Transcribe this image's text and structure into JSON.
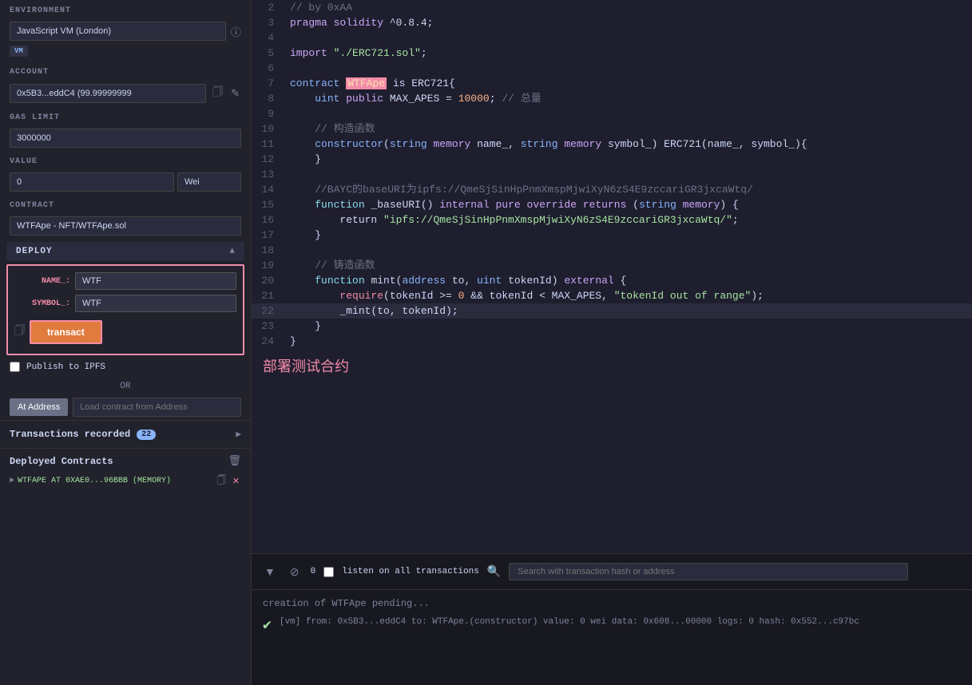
{
  "left_panel": {
    "environment_label": "ENVIRONMENT",
    "environment_value": "JavaScript VM (London)",
    "vm_badge": "VM",
    "account_label": "ACCOUNT",
    "account_value": "0x5B3...eddC4 (99.99999999",
    "gas_limit_label": "GAS LIMIT",
    "gas_limit_value": "3000000",
    "value_label": "VALUE",
    "value_value": "0",
    "value_unit": "Wei",
    "contract_label": "CONTRACT",
    "contract_value": "WTFApe - NFT/WTFApe.sol",
    "deploy_label": "DEPLOY",
    "name_param_label": "NAME_:",
    "name_param_value": "WTF",
    "symbol_param_label": "SYMBOL_:",
    "symbol_param_value": "WTF",
    "transact_btn": "transact",
    "publish_label": "Publish to IPFS",
    "or_text": "OR",
    "at_address_btn": "At Address",
    "load_contract_placeholder": "Load contract from Address",
    "transactions_label": "Transactions recorded",
    "transactions_count": "22",
    "deployed_contracts_label": "Deployed Contracts",
    "deployed_item": "WTFAPE AT 0XAE0...96BBB (MEMORY)"
  },
  "toolbar": {
    "count": "0",
    "listen_label": "listen on all transactions",
    "search_placeholder": "Search with transaction hash or address"
  },
  "code": {
    "lines": [
      {
        "num": 2,
        "content": "// by 0xAA"
      },
      {
        "num": 3,
        "content": "pragma solidity ^0.8.4;"
      },
      {
        "num": 4,
        "content": ""
      },
      {
        "num": 5,
        "content": "import \"./ERC721.sol\";"
      },
      {
        "num": 6,
        "content": ""
      },
      {
        "num": 7,
        "content": "contract WTFApe is ERC721{"
      },
      {
        "num": 8,
        "content": "    uint public MAX_APES = 10000; // 总量"
      },
      {
        "num": 9,
        "content": ""
      },
      {
        "num": 10,
        "content": "    // 构造函数"
      },
      {
        "num": 11,
        "content": "    constructor(string memory name_, string memory symbol_) ERC721(name_, symbol_){"
      },
      {
        "num": 12,
        "content": "    }"
      },
      {
        "num": 13,
        "content": ""
      },
      {
        "num": 14,
        "content": "    //BAYC的baseURI为ipfs://QmeSjSinHpPnmXmspMjwiXyN6zS4E9zccariGR3jxcaWtq/"
      },
      {
        "num": 15,
        "content": "    function _baseURI() internal pure override returns (string memory) {"
      },
      {
        "num": 16,
        "content": "        return \"ipfs://QmeSjSinHpPnmXmspMjwiXyN6zS4E9zccariGR3jxcaWtq/\";"
      },
      {
        "num": 17,
        "content": "    }"
      },
      {
        "num": 18,
        "content": ""
      },
      {
        "num": 19,
        "content": "    // 铸造函数"
      },
      {
        "num": 20,
        "content": "    function mint(address to, uint tokenId) external {"
      },
      {
        "num": 21,
        "content": "        require(tokenId >= 0 && tokenId < MAX_APES, \"tokenId out of range\");"
      },
      {
        "num": 22,
        "content": "        _mint(to, tokenId);"
      },
      {
        "num": 23,
        "content": "    }"
      },
      {
        "num": 24,
        "content": "}"
      }
    ]
  },
  "chinese_annotation": "部署测试合约",
  "console": {
    "pending_text": "creation of WTFApe pending...",
    "tx_text": "[vm] from: 0x5B3...eddC4 to: WTFApe.(constructor) value: 0 wei data: 0x608...00000 logs: 0 hash: 0x552...c97bc"
  }
}
